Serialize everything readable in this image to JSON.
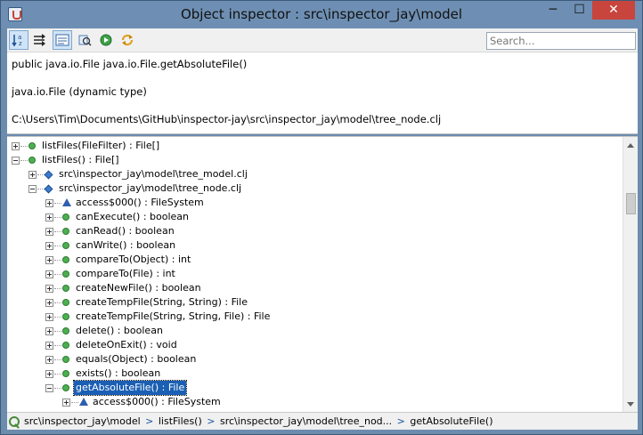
{
  "window": {
    "title": "Object inspector : src\\inspector_jay\\model",
    "minimize": "─",
    "maximize": "☐",
    "close": "✕"
  },
  "toolbar": {
    "buttons": [
      {
        "icon": "sort-alphabetical-icon",
        "active": true
      },
      {
        "icon": "filter-inherited-icon",
        "active": false
      },
      {
        "icon": "details-pane-icon",
        "active": true
      },
      {
        "icon": "inspect-icon",
        "active": false
      },
      {
        "icon": "refresh-icon",
        "active": false
      },
      {
        "icon": "reload-icon",
        "active": false
      }
    ],
    "search_placeholder": "Search..."
  },
  "info": {
    "signature": "public java.io.File java.io.File.getAbsoluteFile()",
    "type": "java.io.File (dynamic type)",
    "value": "C:\\Users\\Tim\\Documents\\GitHub\\inspector-jay\\src\\inspector_jay\\model\\tree_node.clj"
  },
  "tree": {
    "rows": [
      {
        "label": "listFiles(FileFilter) : File[]",
        "icon": "method",
        "level": 0,
        "expander": "plus"
      },
      {
        "label": "listFiles() : File[]",
        "icon": "method",
        "level": 0,
        "expander": "minus"
      },
      {
        "label": "src\\inspector_jay\\model\\tree_model.clj",
        "icon": "file",
        "level": 1,
        "expander": "plus"
      },
      {
        "label": "src\\inspector_jay\\model\\tree_node.clj",
        "icon": "file",
        "level": 1,
        "expander": "minus"
      },
      {
        "label": "access$000() : FileSystem",
        "icon": "field",
        "level": 2,
        "expander": "plus"
      },
      {
        "label": "canExecute() : boolean",
        "icon": "method",
        "level": 2,
        "expander": "plus"
      },
      {
        "label": "canRead() : boolean",
        "icon": "method",
        "level": 2,
        "expander": "plus"
      },
      {
        "label": "canWrite() : boolean",
        "icon": "method",
        "level": 2,
        "expander": "plus"
      },
      {
        "label": "compareTo(Object) : int",
        "icon": "method",
        "level": 2,
        "expander": "plus"
      },
      {
        "label": "compareTo(File) : int",
        "icon": "method",
        "level": 2,
        "expander": "plus"
      },
      {
        "label": "createNewFile() : boolean",
        "icon": "method",
        "level": 2,
        "expander": "plus"
      },
      {
        "label": "createTempFile(String, String) : File",
        "icon": "method",
        "level": 2,
        "expander": "plus"
      },
      {
        "label": "createTempFile(String, String, File) : File",
        "icon": "method",
        "level": 2,
        "expander": "plus"
      },
      {
        "label": "delete() : boolean",
        "icon": "method",
        "level": 2,
        "expander": "plus"
      },
      {
        "label": "deleteOnExit() : void",
        "icon": "method",
        "level": 2,
        "expander": "plus"
      },
      {
        "label": "equals(Object) : boolean",
        "icon": "method",
        "level": 2,
        "expander": "plus"
      },
      {
        "label": "exists() : boolean",
        "icon": "method",
        "level": 2,
        "expander": "plus"
      },
      {
        "label": "getAbsoluteFile() : File",
        "icon": "method",
        "level": 2,
        "expander": "minus",
        "selected": true
      },
      {
        "label": "access$000() : FileSystem",
        "icon": "field",
        "level": 3,
        "expander": "plus"
      }
    ]
  },
  "status": {
    "crumbs": [
      "src\\inspector_jay\\model",
      "listFiles()",
      "src\\inspector_jay\\model\\tree_nod...",
      "getAbsoluteFile()"
    ],
    "separator": ">"
  },
  "colors": {
    "titlebar": "#6e8fb3",
    "selection": "#1a5fb4",
    "method_icon": "#4caf50",
    "file_icon": "#3d7bd0",
    "field_icon": "#2e5fae"
  }
}
